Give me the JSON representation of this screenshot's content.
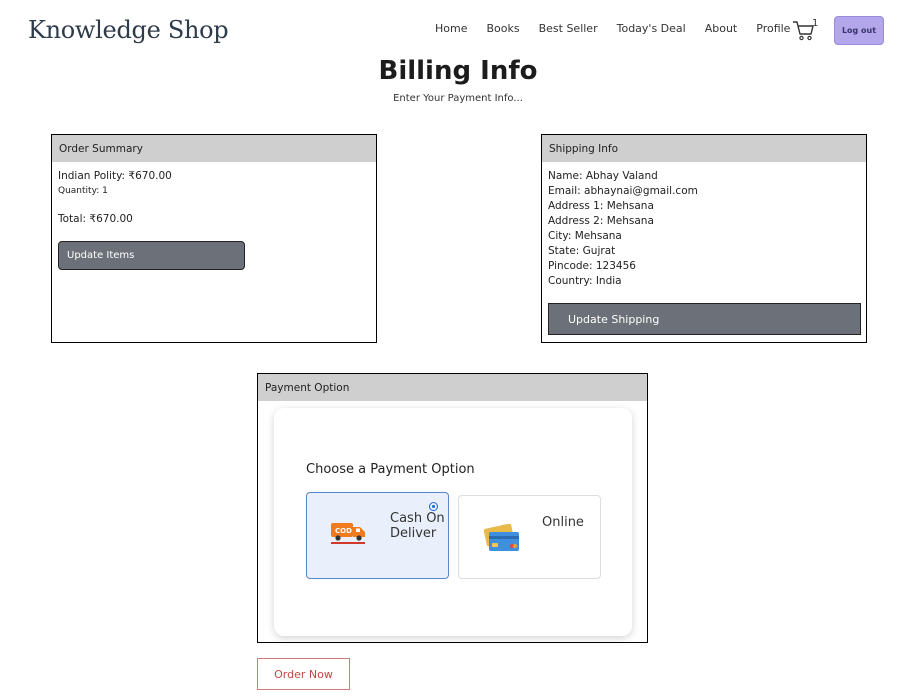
{
  "header": {
    "brand": "Knowledge Shop",
    "nav": [
      "Home",
      "Books",
      "Best Seller",
      "Today's Deal",
      "About",
      "Profile"
    ],
    "cart_count": "1",
    "logout_label": "Log out"
  },
  "page": {
    "title": "Billing Info",
    "subtitle": "Enter Your Payment Info..."
  },
  "order_summary": {
    "heading": "Order Summary",
    "item": "Indian Polity: ₹670.00",
    "quantity": "Quantity: 1",
    "total": "Total: ₹670.00",
    "update_button": "Update Items"
  },
  "shipping": {
    "heading": "Shipping Info",
    "name": "Name: Abhay Valand",
    "email": "Email: abhaynai@gmail.com",
    "address1": "Address 1: Mehsana",
    "address2": "Address 2: Mehsana",
    "city": "City: Mehsana",
    "state": "State: Gujrat",
    "pincode": "Pincode: 123456",
    "country": "Country: India",
    "update_button": "Update Shipping"
  },
  "payment": {
    "heading": "Payment Option",
    "choose_label": "Choose a Payment Option",
    "options": [
      {
        "label": "Cash On Deliver",
        "icon": "cod-truck-icon",
        "selected": true
      },
      {
        "label": "Online",
        "icon": "credit-card-icon",
        "selected": false
      }
    ],
    "order_now": "Order Now"
  },
  "colors": {
    "logout_bg": "#b3a6ea",
    "card_header": "#cfcfcf",
    "dark_button": "#6b7079",
    "selected_option_bg": "#e9f0fb",
    "order_now_text": "#c24444"
  }
}
